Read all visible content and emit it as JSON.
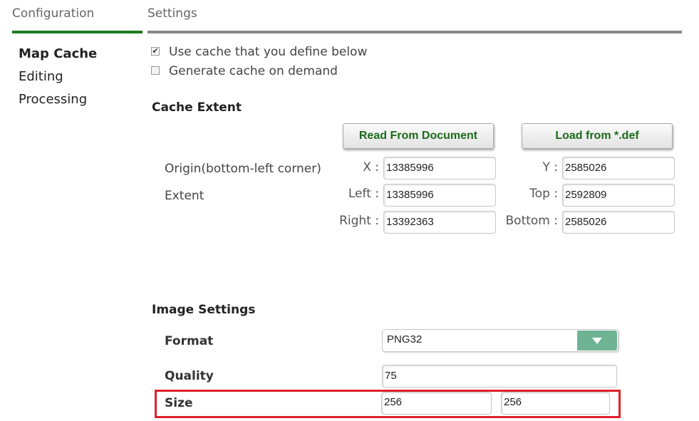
{
  "tabs": [
    {
      "label": "Configuration"
    },
    {
      "label": "Settings"
    }
  ],
  "sidebar": {
    "items": [
      {
        "label": "Map Cache",
        "active": true
      },
      {
        "label": "Editing"
      },
      {
        "label": "Processing"
      }
    ]
  },
  "cache_options": {
    "use_defined": {
      "label": "Use cache that you define below",
      "checked": true
    },
    "on_demand": {
      "label": "Generate cache on demand",
      "checked": false
    }
  },
  "cache_extent": {
    "title": "Cache Extent",
    "read_from_document": "Read From Document",
    "load_from_def": "Load from *.def",
    "origin_label": "Origin(bottom-left corner)",
    "extent_label": "Extent",
    "x_label": "X :",
    "x_value": "13385996",
    "y_label": "Y :",
    "y_value": "2585026",
    "left_label": "Left :",
    "left_value": "13385996",
    "top_label": "Top :",
    "top_value": "2592809",
    "right_label": "Right :",
    "right_value": "13392363",
    "bottom_label": "Bottom :",
    "bottom_value": "2585026"
  },
  "image_settings": {
    "title": "Image Settings",
    "format_label": "Format",
    "format_value": "PNG32",
    "quality_label": "Quality",
    "quality_value": "75",
    "size_label": "Size",
    "size_width": "256",
    "size_height": "256"
  },
  "colors": {
    "active_tab_bar": "#1f7a1f",
    "button_text": "#1b6b1b",
    "select_button": "#6fb394",
    "highlight": "#e0202a"
  },
  "icons": {
    "checkbox_checked": "checkmark-icon",
    "select": "chevron-down-icon"
  }
}
